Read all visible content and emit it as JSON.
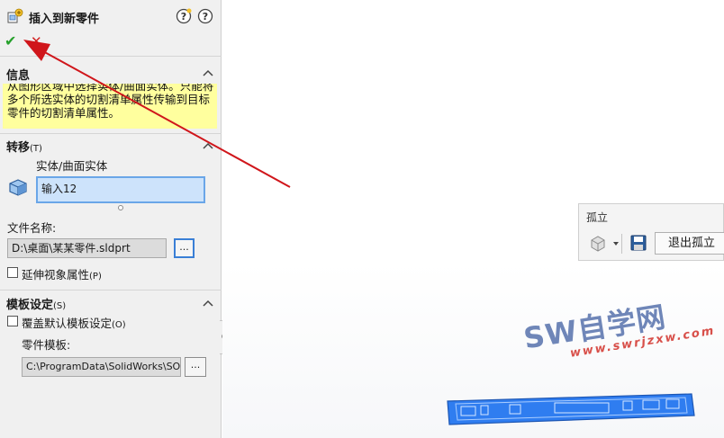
{
  "panel": {
    "title": "插入到新零件",
    "sections": {
      "info": {
        "heading": "信息",
        "text": "从图形区域中选择实体/曲面实体。只能将多个所选实体的切割清单属性传输到目标零件的切割清单属性。"
      },
      "transfer": {
        "heading": "转移",
        "shortcut": "(T)",
        "selection_label": "实体/曲面实体",
        "selection_item": "输入12",
        "file_name_label": "文件名称:",
        "file_path": "D:\\桌面\\某某零件.sldprt",
        "browse_label": "...",
        "extend_label": "延伸视象属性",
        "extend_shortcut": "(P)"
      },
      "template": {
        "heading": "模板设定",
        "shortcut": "(S)",
        "override_label": "覆盖默认模板设定",
        "override_shortcut": "(O)",
        "template_label": "零件模板:",
        "template_path": "C:\\ProgramData\\SolidWorks\\SOLI",
        "browse_label": "..."
      }
    }
  },
  "isolate_toolbar": {
    "title": "孤立",
    "exit_label": "退出孤立"
  },
  "watermark": {
    "main": "SW自学网",
    "sub": "www.swrjzxw.com"
  },
  "colors": {
    "accent_arrow": "#d0161b",
    "info_bg": "#ffff9e",
    "selection_bg": "#cde3fb",
    "part_blue": "#2f7df0"
  }
}
